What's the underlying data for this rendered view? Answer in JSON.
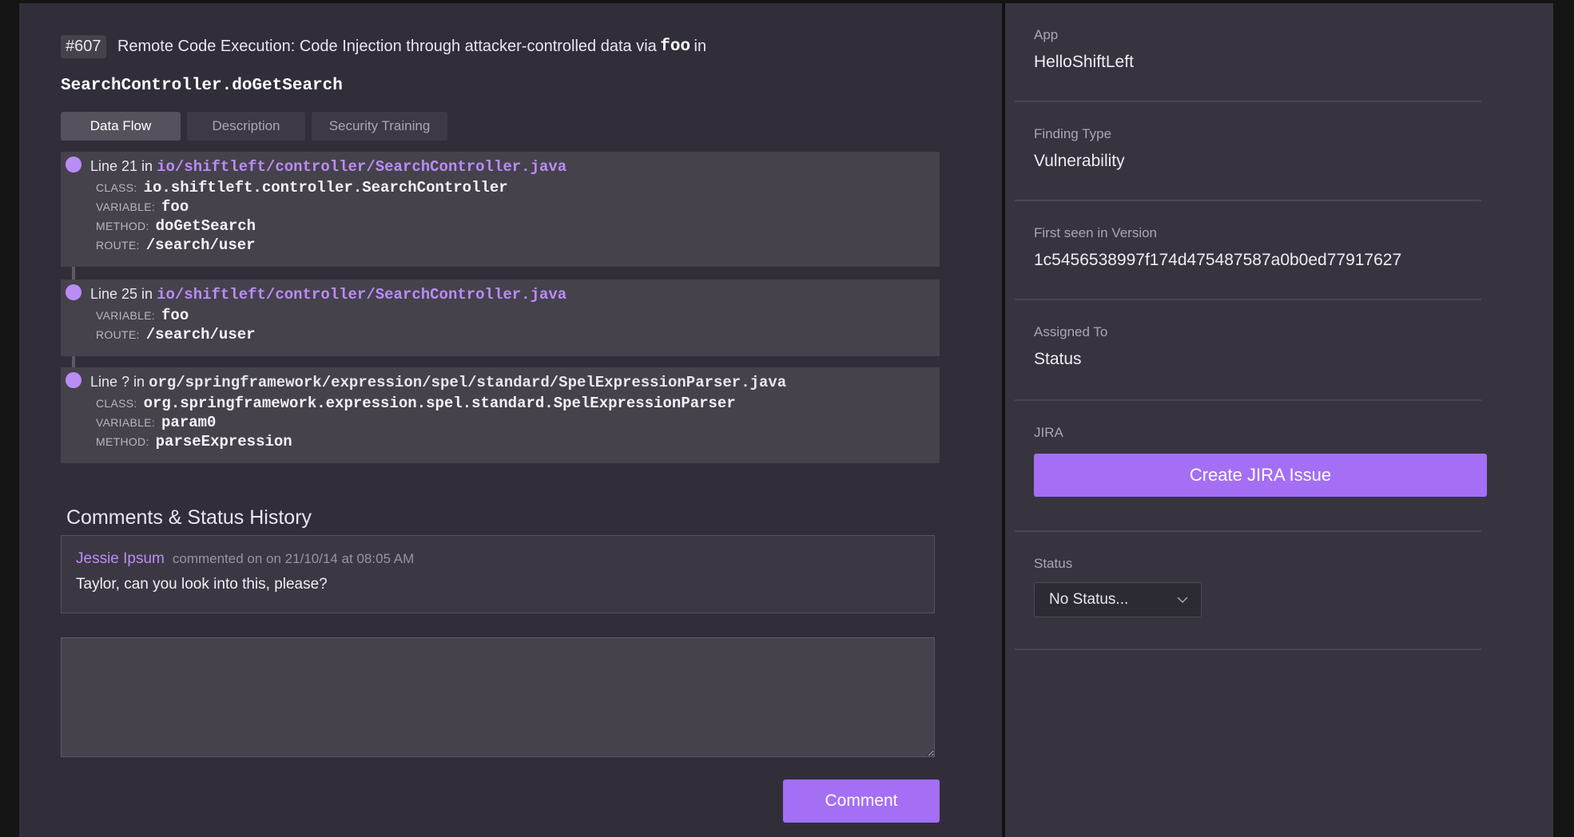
{
  "issue": {
    "number": "#607",
    "title_prefix": "Remote Code Execution: Code Injection through attacker-controlled data via",
    "title_var": "foo",
    "title_in": "in",
    "title_method": "SearchController.doGetSearch"
  },
  "tabs": [
    {
      "label": "Data Flow",
      "active": true
    },
    {
      "label": "Description",
      "active": false
    },
    {
      "label": "Security Training",
      "active": false
    }
  ],
  "flow": [
    {
      "line_label": "Line 21 in",
      "path": "io/shiftleft/controller/SearchController.java",
      "class_label": "CLASS:",
      "class": "io.shiftleft.controller.SearchController",
      "variable_label": "VARIABLE:",
      "variable": "foo",
      "method_label": "METHOD:",
      "method": "doGetSearch",
      "route_label": "ROUTE:",
      "route": "/search/user"
    },
    {
      "line_label": "Line 25 in",
      "path": "io/shiftleft/controller/SearchController.java",
      "variable_label": "VARIABLE:",
      "variable": "foo",
      "route_label": "ROUTE:",
      "route": "/search/user"
    },
    {
      "line_label": "Line ? in",
      "path": "org/springframework/expression/spel/standard/SpelExpressionParser.java",
      "class_label": "CLASS:",
      "class": "org.springframework.expression.spel.standard.SpelExpressionParser",
      "variable_label": "VARIABLE:",
      "variable": "param0",
      "method_label": "METHOD:",
      "method": "parseExpression"
    }
  ],
  "comments": {
    "title": "Comments & Status History",
    "items": [
      {
        "author": "Jessie Ipsum",
        "meta": "commented on on 21/10/14 at 08:05 AM",
        "text": "Taylor, can you look into this, please?"
      }
    ],
    "input_placeholder": "",
    "submit_label": "Comment"
  },
  "details": {
    "app_label": "App",
    "app": "HelloShiftLeft",
    "finding_type_label": "Finding Type",
    "finding_type": "Vulnerability",
    "first_seen_label": "First seen in Version",
    "first_seen": "1c5456538997f174d475487587a0b0ed77917627",
    "assigned_label": "Assigned To",
    "assigned": "Status",
    "jira_label": "JIRA",
    "jira_button": "Create JIRA Issue",
    "status_label": "Status",
    "status_value": "No Status..."
  },
  "colors": {
    "accent": "#a46ef5",
    "link": "#bb8cf6"
  }
}
